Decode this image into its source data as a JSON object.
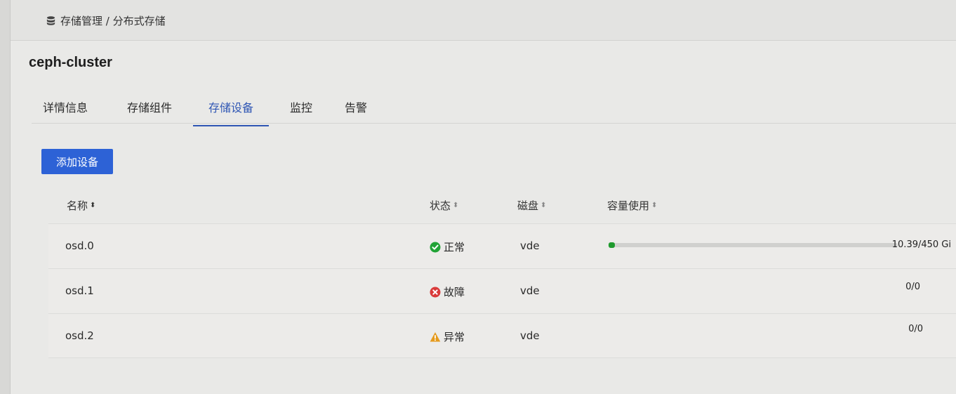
{
  "breadcrumb": {
    "icon": "database-icon",
    "text": "存储管理 / 分布式存储"
  },
  "cluster": {
    "name": "ceph-cluster"
  },
  "tabs": [
    {
      "label": "详情信息"
    },
    {
      "label": "存储组件"
    },
    {
      "label": "存储设备",
      "active": true
    },
    {
      "label": "监控"
    },
    {
      "label": "告警"
    }
  ],
  "actions": {
    "add_device": "添加设备"
  },
  "table": {
    "headers": {
      "name": "名称",
      "status": "状态",
      "disk": "磁盘",
      "usage": "容量使用"
    },
    "rows": [
      {
        "name": "osd.0",
        "status": "正常",
        "status_icon": "check-circle-icon",
        "status_color": "#21a336",
        "disk": "vde",
        "usage": "10.39/450 Gi",
        "usage_fraction": 0.023
      },
      {
        "name": "osd.1",
        "status": "故障",
        "status_icon": "error-circle-icon",
        "status_color": "#d93a3a",
        "disk": "vde",
        "usage": "0/0"
      },
      {
        "name": "osd.2",
        "status": "异常",
        "status_icon": "warning-triangle-icon",
        "status_color": "#e59a1c",
        "disk": "vde",
        "usage": "0/0"
      }
    ]
  }
}
